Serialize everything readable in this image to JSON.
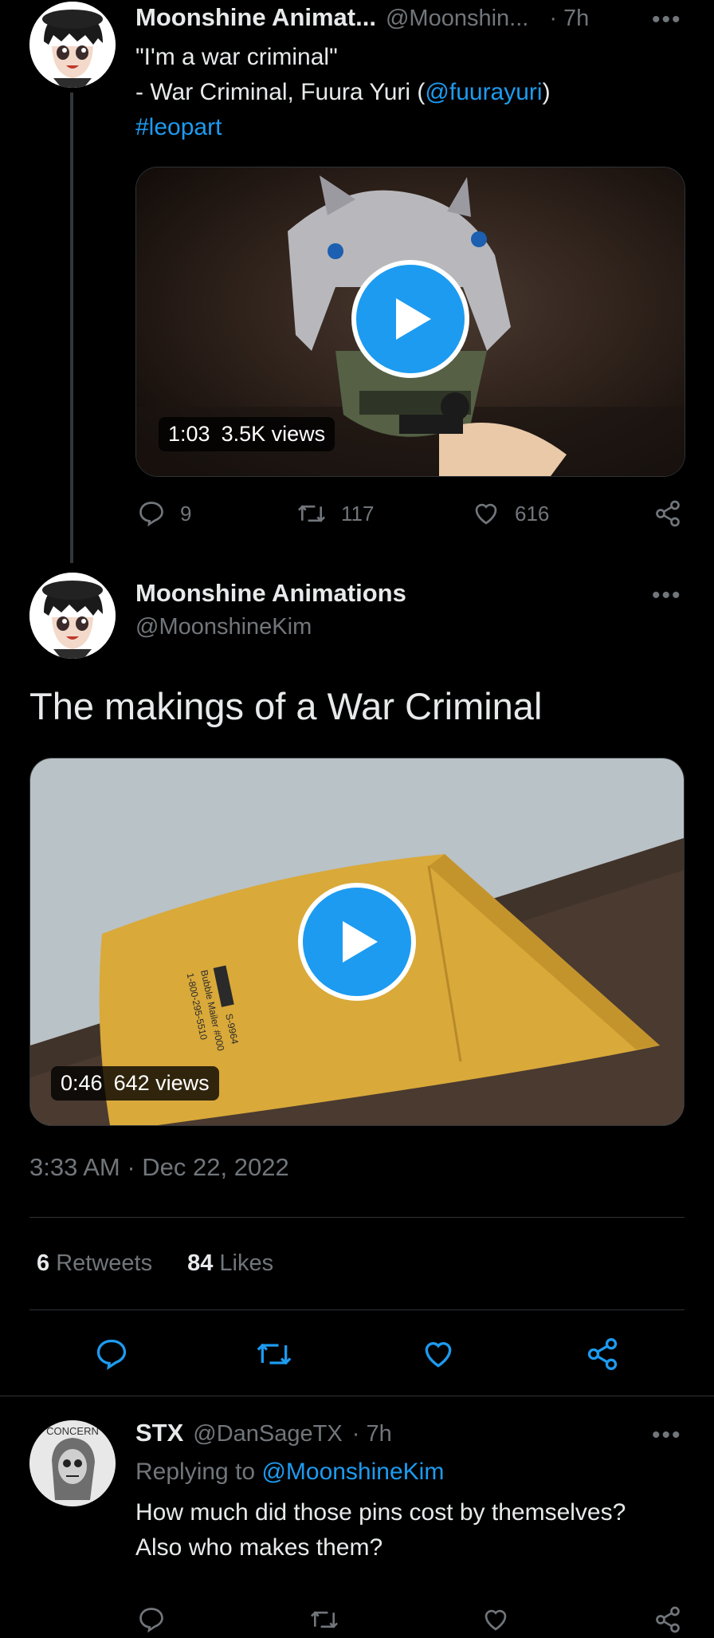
{
  "thread_tweet": {
    "display_name": "Moonshine Animat...",
    "handle": "@Moonshin...",
    "time": "· 7h",
    "more": "•••",
    "line1": "\"I'm a war criminal\"",
    "line2_prefix": "- War Criminal, Fuura Yuri (",
    "line2_mention": "@fuurayuri",
    "line2_suffix": ")",
    "hashtag": "#leopart",
    "video": {
      "duration": "1:03",
      "views": "3.5K views"
    },
    "actions": {
      "replies": "9",
      "retweets": "117",
      "likes": "616"
    }
  },
  "main_tweet": {
    "display_name": "Moonshine Animations",
    "handle": "@MoonshineKim",
    "more": "•••",
    "text": "The makings of a War Criminal",
    "video": {
      "duration": "0:46",
      "views": "642 views"
    },
    "timestamp": "3:33 AM · Dec 22, 2022",
    "stats": {
      "retweets_count": "6",
      "retweets_label": "Retweets",
      "likes_count": "84",
      "likes_label": "Likes"
    },
    "envelope_label_lines": [
      "S-9964",
      "Bubble Mailer #000",
      "1-800-295-5510"
    ]
  },
  "reply_tweet": {
    "display_name": "STX",
    "handle": "@DanSageTX",
    "time": "· 7h",
    "more": "•••",
    "replying_prefix": "Replying to ",
    "replying_to": "@MoonshineKim",
    "text_line1": "How much did those pins cost by themselves?",
    "text_line2": "Also who makes them?",
    "avatar_text": "CONCERN"
  },
  "colors": {
    "accent": "#1d9bf0",
    "background": "#000000",
    "muted": "#71767b",
    "divider": "#2f3336"
  },
  "icons": [
    "reply-icon",
    "retweet-icon",
    "like-icon",
    "share-icon",
    "play-icon",
    "more-icon"
  ]
}
